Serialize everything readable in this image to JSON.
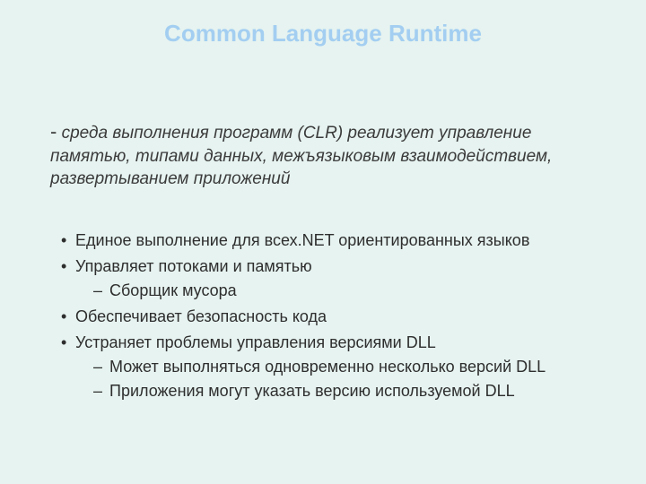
{
  "title": "Common Language Runtime",
  "intro_dash": "-",
  "intro": "среда выполнения программ (CLR) реализует управление памятью, типами данных, межъязыковым взаимодействием, развертыванием  приложений",
  "bullets": {
    "b0": "Единое выполнение для всех.NET ориентированных языков",
    "b1": "Управляет потоками и памятью",
    "b1_0": "Сборщик мусора",
    "b2": "Обеспечивает безопасность кода",
    "b3": "Устраняет проблемы управления версиями DLL",
    "b3_0": "Может выполняться одновременно несколько версий DLL",
    "b3_1": "Приложения могут указать версию используемой DLL"
  }
}
